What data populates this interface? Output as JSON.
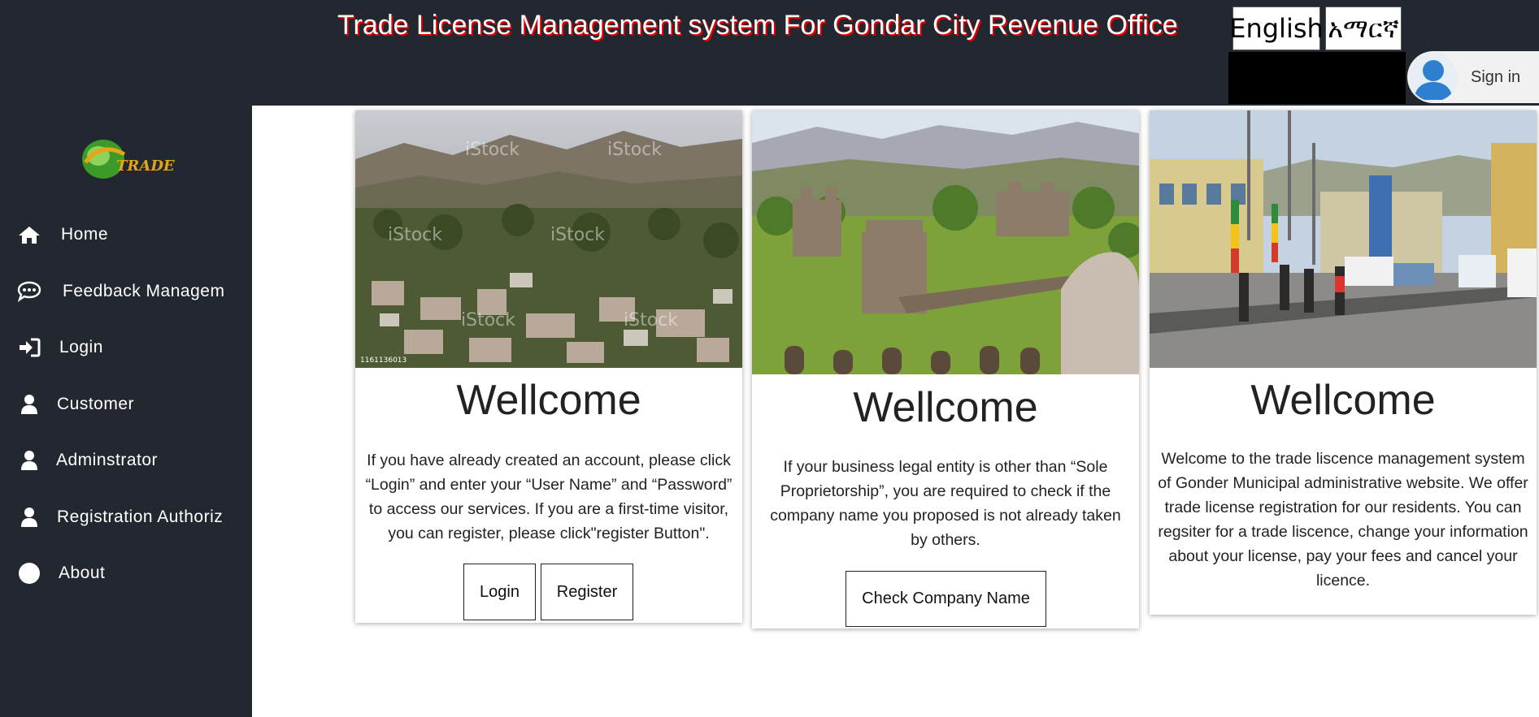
{
  "header": {
    "title": "Trade License Management system For Gondar City Revenue Office",
    "languages": [
      "English",
      "አማርኛ"
    ],
    "sign_in_label": "Sign in"
  },
  "logo": {
    "name": "logo-icon",
    "text": "TRADE"
  },
  "sidebar": {
    "items": [
      {
        "icon": "home-icon",
        "label": "Home"
      },
      {
        "icon": "feedback-icon",
        "label": "Feedback Managem"
      },
      {
        "icon": "login-icon",
        "label": "Login"
      },
      {
        "icon": "user-icon",
        "label": "Customer"
      },
      {
        "icon": "user-icon",
        "label": "Adminstrator"
      },
      {
        "icon": "user-icon",
        "label": "Registration Authoriz"
      },
      {
        "icon": "circle-icon",
        "label": "About"
      }
    ]
  },
  "cards": [
    {
      "image": "city-panorama-photo",
      "watermark": "iStock",
      "image_id": "1161136013",
      "heading": "Wellcome",
      "text": "If you have already created an account, please click “Login” and enter your “User Name” and “Password” to access our services. If you are a first-time visitor, you can register, please click\"register Button\".",
      "buttons": [
        "Login",
        "Register"
      ]
    },
    {
      "image": "castle-photo",
      "heading": "Wellcome",
      "text": "If your business legal entity is other than “Sole Proprietorship”, you are required to check if the company name you proposed is not already taken by others.",
      "buttons": [
        "Check Company Name"
      ]
    },
    {
      "image": "street-photo",
      "heading": "Wellcome",
      "text": "Welcome to the trade liscence management system of Gonder Municipal administrative website. We offer trade license registration for our residents. You can regsiter for a trade liscence, change your information about your license, pay your fees and cancel your licence.",
      "buttons": []
    }
  ],
  "colors": {
    "nav_background": "#232730",
    "title_shadow": "#e00000",
    "accent_blue": "#2f7fd0"
  }
}
